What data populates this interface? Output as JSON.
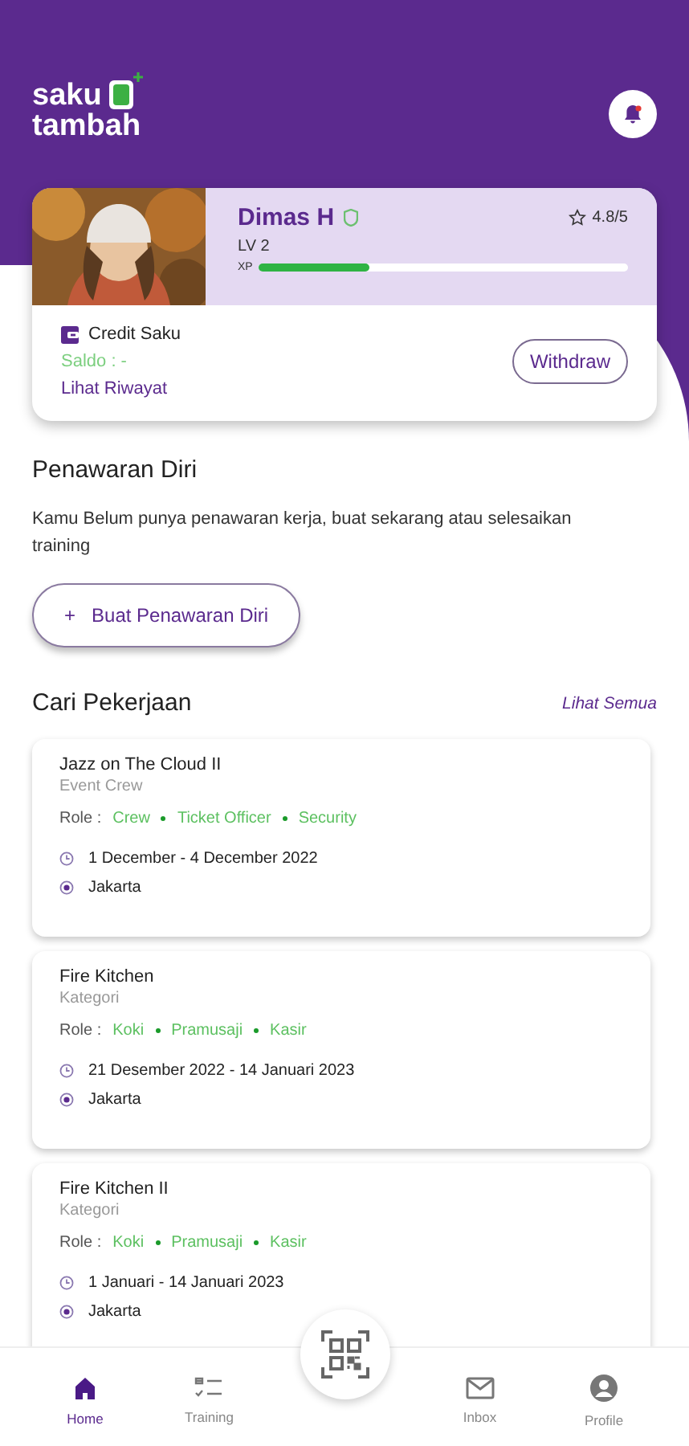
{
  "header": {
    "logo_top": "saku",
    "logo_bottom": "tambah"
  },
  "profile": {
    "name": "Dimas H",
    "rating": "4.8/5",
    "level_label": "LV 2",
    "xp_label": "XP",
    "xp": {
      "level": 0.3
    },
    "credit_label": "Credit Saku",
    "saldo": "Saldo : -",
    "history_link": "Lihat Riwayat",
    "withdraw_button": "Withdraw"
  },
  "offer": {
    "title": "Penawaran Diri",
    "message": "Kamu Belum punya penawaran kerja, buat sekarang atau selesaikan training",
    "button": "Buat Penawaran Diri",
    "button_icon": "+"
  },
  "jobs": {
    "title": "Cari Pekerjaan",
    "see_all": "Lihat Semua",
    "items": [
      {
        "title": "Jazz on The Cloud II",
        "category": "Event Crew",
        "role_label": "Role :",
        "roles": [
          "Crew",
          "Ticket Officer",
          "Security"
        ],
        "dates": "1 December - 4 December 2022",
        "location": "Jakarta"
      },
      {
        "title": "Fire Kitchen",
        "category": "Kategori",
        "role_label": "Role :",
        "roles": [
          "Koki",
          "Pramusaji",
          "Kasir"
        ],
        "dates": "21 Desember 2022 - 14 Januari 2023",
        "location": "Jakarta"
      },
      {
        "title": "Fire Kitchen II",
        "category": "Kategori",
        "role_label": "Role :",
        "roles": [
          "Koki",
          "Pramusaji",
          "Kasir"
        ],
        "dates": "1 Januari - 14 Januari 2023",
        "location": "Jakarta"
      }
    ]
  },
  "nav": [
    {
      "label": "Home",
      "selected": true
    },
    {
      "label": "Training",
      "selected": false
    },
    {
      "label": "Inbox",
      "selected": false
    },
    {
      "label": "Profile",
      "selected": false
    }
  ]
}
